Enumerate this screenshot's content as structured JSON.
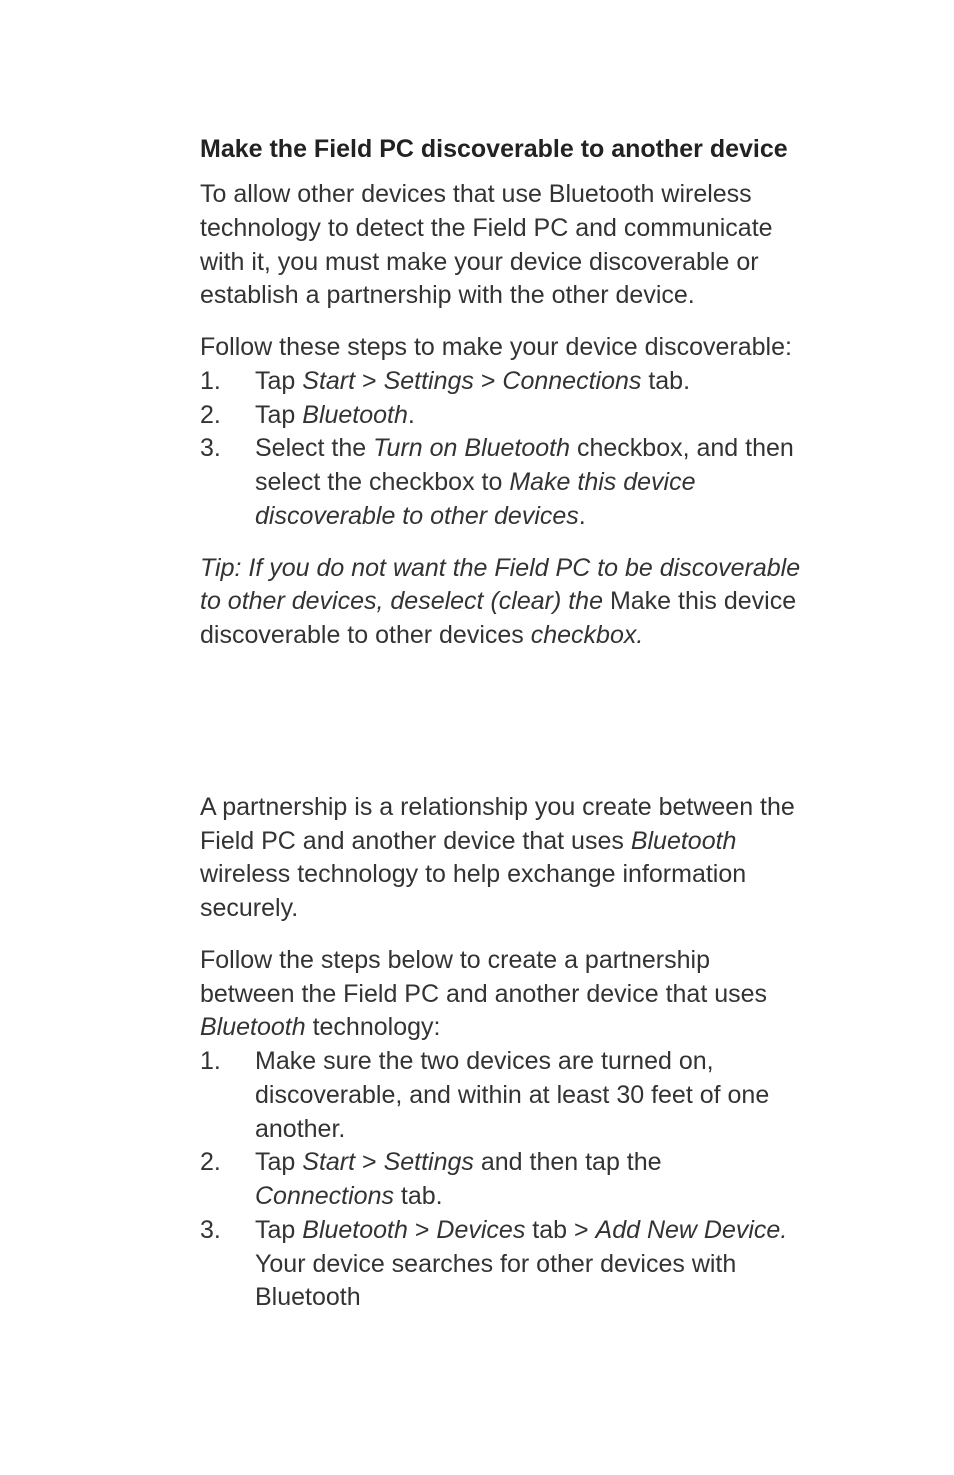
{
  "section1": {
    "heading": "Make the Field PC discoverable to another device",
    "para1": "To allow other devices that use Bluetooth wireless technology to detect the Field PC and communicate with it, you must make your device discoverable or establish a partnership with the other device.",
    "intro": "Follow these steps to make your device discoverable:",
    "list": {
      "item1_pre": "Tap ",
      "item1_i1": "Start",
      "item1_mid1": " > ",
      "item1_i2": "Settings",
      "item1_mid2": " > ",
      "item1_i3": "Connections",
      "item1_post": " tab.",
      "item2_pre": "Tap ",
      "item2_i1": "Bluetooth",
      "item2_post": ".",
      "item3_pre": "Select the ",
      "item3_i1": "Turn on Bluetooth",
      "item3_mid": " checkbox, and then select the checkbox to ",
      "item3_i2": "Make this device discoverable to other devices",
      "item3_post": "."
    },
    "tip_i1": "Tip: If you do not want the Field PC to be discoverable to other devices, deselect (clear) the ",
    "tip_plain": "Make this device discoverable to other devices",
    "tip_i2": " checkbox."
  },
  "section2": {
    "para1_pre": "A partnership is a relationship you create between the Field PC and another device that uses ",
    "para1_i1": "Bluetooth",
    "para1_post": " wireless technology to help exchange information securely.",
    "intro_pre": "Follow the steps below to create a partnership between the Field PC and another device that uses ",
    "intro_i1": "Bluetooth",
    "intro_post": " technology:",
    "list": {
      "item1": "Make sure the two devices are turned on, discoverable, and within at least 30 feet of one another.",
      "item2_pre": "Tap ",
      "item2_i1": "Start",
      "item2_mid1": " > ",
      "item2_i2": "Settings",
      "item2_mid2": " and then tap the ",
      "item2_i3": "Connections",
      "item2_post": " tab.",
      "item3_pre": "Tap ",
      "item3_i1": "Bluetooth",
      "item3_mid1": " > ",
      "item3_i2": "Devices",
      "item3_mid2": " tab > ",
      "item3_i3": "Add New Device.",
      "item3_post": " Your device searches for other devices with Bluetooth"
    }
  }
}
